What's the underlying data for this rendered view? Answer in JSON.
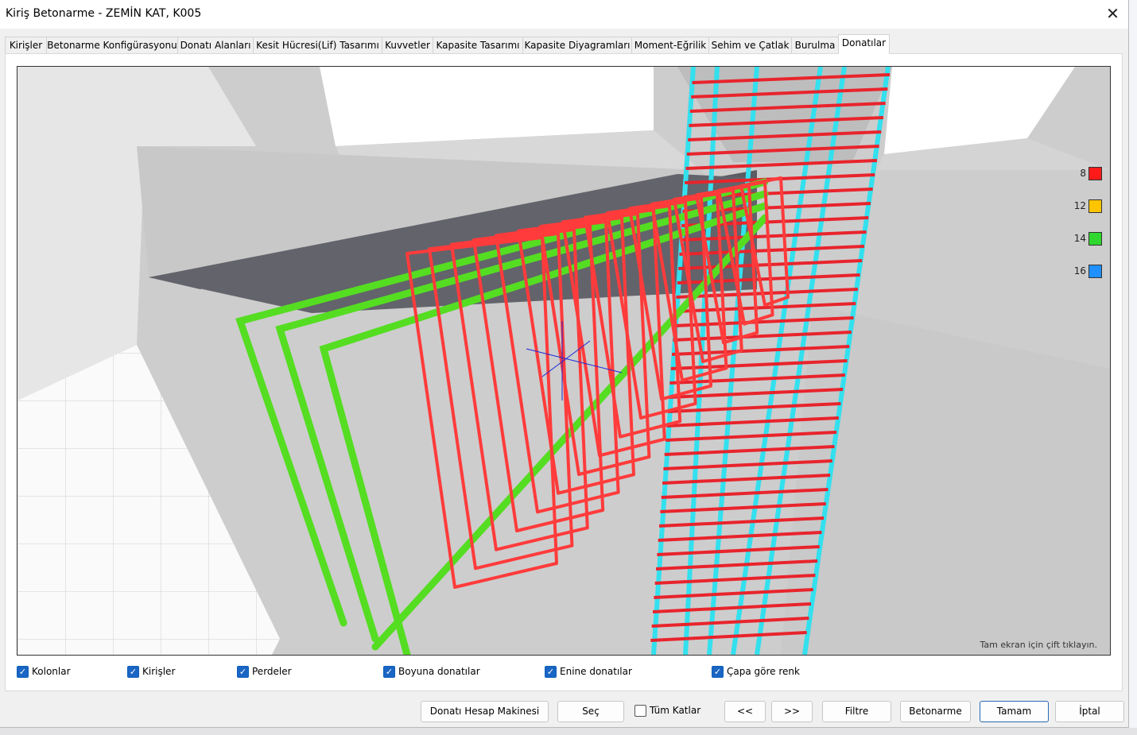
{
  "window": {
    "title": "Kiriş Betonarme - ZEMİN KAT, K005",
    "close_icon": "close-icon"
  },
  "tabs": [
    {
      "label": "Kirişler"
    },
    {
      "label": "Betonarme Konfigürasyonu"
    },
    {
      "label": "Donatı Alanları"
    },
    {
      "label": "Kesit Hücresi(Lif) Tasarımı"
    },
    {
      "label": "Kuvvetler"
    },
    {
      "label": "Kapasite Tasarımı"
    },
    {
      "label": "Kapasite Diyagramları"
    },
    {
      "label": "Moment-Eğrilik"
    },
    {
      "label": "Sehim ve Çatlak"
    },
    {
      "label": "Burulma"
    },
    {
      "label": "Donatılar"
    }
  ],
  "active_tab": "Donatılar",
  "viewport": {
    "hint": "Tam ekran için çift tıklayın."
  },
  "legend": [
    {
      "label": "8",
      "color": "#ff1a1a"
    },
    {
      "label": "12",
      "color": "#ffc400"
    },
    {
      "label": "14",
      "color": "#2ed82e"
    },
    {
      "label": "16",
      "color": "#1e90ff"
    }
  ],
  "colors": {
    "stirrup": "#ff3333",
    "longitudinal": "#55dd22",
    "column_bar": "#33ddee",
    "accent": "#1a66c4"
  },
  "checkboxes": [
    {
      "label": "Kolonlar",
      "checked": true
    },
    {
      "label": "Kirişler",
      "checked": true
    },
    {
      "label": "Perdeler",
      "checked": true
    },
    {
      "label": "Boyuna donatılar",
      "checked": true
    },
    {
      "label": "Enine donatılar",
      "checked": true
    },
    {
      "label": "Çapa göre renk",
      "checked": true
    }
  ],
  "buttons": {
    "calc": "Donatı Hesap Makinesi",
    "select": "Seç",
    "all_floors": "Tüm Katlar",
    "prev": "<<",
    "next": ">>",
    "filter": "Filtre",
    "concrete": "Betonarme",
    "ok": "Tamam",
    "cancel": "İptal"
  }
}
